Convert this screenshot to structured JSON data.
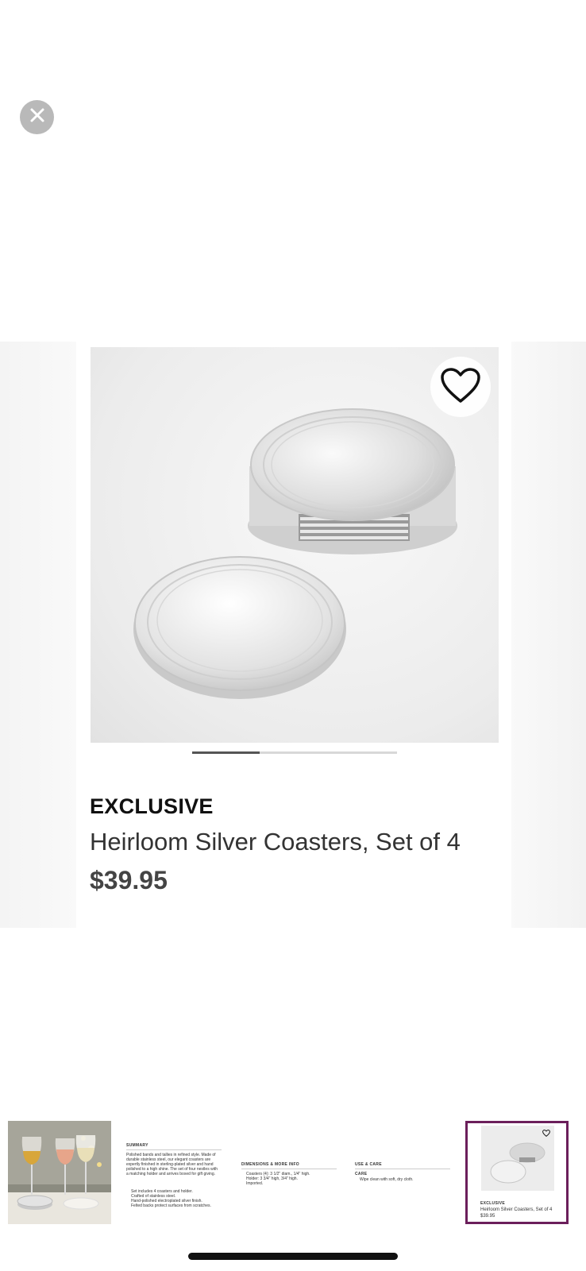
{
  "product": {
    "badge": "EXCLUSIVE",
    "title": "Heirloom Silver Coasters, Set of 4",
    "price": "$39.95",
    "gallery_progress": 0.33
  },
  "icons": {
    "close": "close-icon",
    "favorite": "heart-outline-icon"
  },
  "thumbnails": {
    "summary": {
      "heading": "SUMMARY",
      "body": "Polished bands and tallies in refined style. Made of durable stainless steel, our elegant coasters are expertly finished in sterling-plated silver and hand polished to a high shine. The set of four nestles with a matching holder and arrives boxed for gift giving.",
      "bullets": [
        "Set includes 4 coasters and holder.",
        "Crafted of stainless steel.",
        "Hand-polished electroplated silver finish.",
        "Felted backs protect surfaces from scratches."
      ]
    },
    "dimensions": {
      "heading": "DIMENSIONS & MORE INFO",
      "bullets": [
        "Coasters (4): 3 1/2\" diam., 1/4\" high.",
        "Holder: 3 3/4\" high, 3/4\" high.",
        "Imported."
      ]
    },
    "care": {
      "heading": "USE & CARE",
      "subheading": "CARE",
      "bullets": [
        "Wipe clean with soft, dry cloth."
      ]
    },
    "current": {
      "badge": "EXCLUSIVE",
      "title": "Heirloom Silver Coasters, Set of 4",
      "price": "$39.95"
    }
  }
}
